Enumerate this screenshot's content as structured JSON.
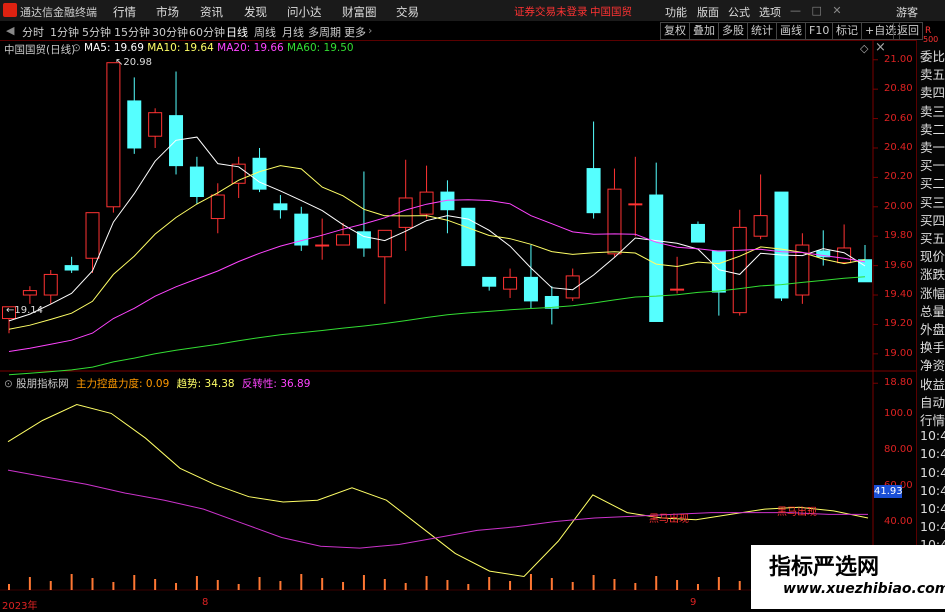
{
  "app": {
    "title": "通达信金融终端",
    "status": "证券交易未登录",
    "stock_name": "中国国贸"
  },
  "menu": [
    "行情",
    "市场",
    "资讯",
    "发现",
    "问小达",
    "财富圈",
    "交易"
  ],
  "right_menu": [
    "功能",
    "版面",
    "公式",
    "选项"
  ],
  "guest": "游客",
  "periods": [
    "分时",
    "1分钟",
    "5分钟",
    "15分钟",
    "30分钟",
    "60分钟",
    "日线",
    "周线",
    "月线",
    "多周期",
    "更多"
  ],
  "active_period": "日线",
  "tools": [
    "复权",
    "叠加",
    "多股",
    "统计",
    "画线",
    "F10",
    "标记",
    "+自选",
    "返回"
  ],
  "right_panel_top": {
    "r": "R",
    "num": "500"
  },
  "right_panel": [
    "委比",
    "卖五",
    "卖四",
    "卖三",
    "卖二",
    "卖一",
    "买一",
    "买二",
    "买三",
    "买四",
    "买五",
    "现价",
    "涨跌",
    "涨幅",
    "总量",
    "外盘",
    "换手",
    "净资",
    "收益",
    "自动",
    "行情",
    "10:4",
    "10:45",
    "10:45",
    "10:45",
    "10:45",
    "10:45",
    "10:45",
    "10:45",
    "10:45",
    "10:45"
  ],
  "main_chart": {
    "label": "中国国贸(日线)",
    "ma": [
      {
        "name": "MA5",
        "value": "19.69",
        "color": "#ffffff"
      },
      {
        "name": "MA10",
        "value": "19.64",
        "color": "#ffff66"
      },
      {
        "name": "MA20",
        "value": "19.66",
        "color": "#ff44ff"
      },
      {
        "name": "MA60",
        "value": "19.50",
        "color": "#33dd33"
      }
    ],
    "high_label": "20.98",
    "low_label": "19.14",
    "y_ticks": [
      "21.00",
      "20.80",
      "20.60",
      "20.40",
      "20.20",
      "20.00",
      "19.80",
      "19.60",
      "19.40",
      "19.20",
      "19.00",
      "18.80"
    ],
    "y_range": [
      18.72,
      21.08
    ]
  },
  "sub_chart": {
    "label": "股朋指标网",
    "items": [
      {
        "name": "主力控盘力度",
        "value": "0.09",
        "color": "#ff9900"
      },
      {
        "name": "趋势",
        "value": "34.38",
        "color": "#ffff66"
      },
      {
        "name": "反转性",
        "value": "36.89",
        "color": "#ff44ff"
      }
    ],
    "y_ticks": [
      "100.0",
      "80.00",
      "60.00",
      "40.00"
    ],
    "current": "41.93",
    "annotation1": "黑马出现",
    "annotation2": "黑马出现"
  },
  "x_labels": [
    "2023年",
    "8",
    "9"
  ],
  "watermark": {
    "line1": "指标严选网",
    "line2": "www.xuezhibiao.com"
  },
  "chart_data": {
    "type": "candlestick",
    "candles": [
      {
        "o": 19.24,
        "h": 19.32,
        "l": 19.14,
        "c": 19.32
      },
      {
        "o": 19.4,
        "h": 19.46,
        "l": 19.34,
        "c": 19.43
      },
      {
        "o": 19.4,
        "h": 19.57,
        "l": 19.34,
        "c": 19.54
      },
      {
        "o": 19.6,
        "h": 19.66,
        "l": 19.55,
        "c": 19.57
      },
      {
        "o": 19.65,
        "h": 19.82,
        "l": 19.55,
        "c": 19.96
      },
      {
        "o": 20.0,
        "h": 20.98,
        "l": 19.96,
        "c": 20.98
      },
      {
        "o": 20.72,
        "h": 20.88,
        "l": 20.36,
        "c": 20.4
      },
      {
        "o": 20.48,
        "h": 20.67,
        "l": 20.4,
        "c": 20.64
      },
      {
        "o": 20.62,
        "h": 20.92,
        "l": 20.22,
        "c": 20.28
      },
      {
        "o": 20.27,
        "h": 20.34,
        "l": 20.02,
        "c": 20.07
      },
      {
        "o": 19.92,
        "h": 20.16,
        "l": 19.82,
        "c": 20.08
      },
      {
        "o": 20.16,
        "h": 20.34,
        "l": 20.06,
        "c": 20.29
      },
      {
        "o": 20.33,
        "h": 20.4,
        "l": 20.1,
        "c": 20.12
      },
      {
        "o": 20.02,
        "h": 20.08,
        "l": 19.92,
        "c": 19.98
      },
      {
        "o": 19.95,
        "h": 20.0,
        "l": 19.7,
        "c": 19.74
      },
      {
        "o": 19.74,
        "h": 19.92,
        "l": 19.64,
        "c": 19.74
      },
      {
        "o": 19.74,
        "h": 19.89,
        "l": 19.74,
        "c": 19.81
      },
      {
        "o": 19.83,
        "h": 20.24,
        "l": 19.66,
        "c": 19.72
      },
      {
        "o": 19.66,
        "h": 19.78,
        "l": 19.34,
        "c": 19.84
      },
      {
        "o": 19.86,
        "h": 20.32,
        "l": 19.7,
        "c": 20.06
      },
      {
        "o": 19.95,
        "h": 20.28,
        "l": 19.92,
        "c": 20.1
      },
      {
        "o": 20.1,
        "h": 20.18,
        "l": 19.82,
        "c": 19.98
      },
      {
        "o": 19.99,
        "h": 19.99,
        "l": 19.6,
        "c": 19.6
      },
      {
        "o": 19.52,
        "h": 19.52,
        "l": 19.43,
        "c": 19.46
      },
      {
        "o": 19.44,
        "h": 19.58,
        "l": 19.38,
        "c": 19.52
      },
      {
        "o": 19.52,
        "h": 19.74,
        "l": 19.31,
        "c": 19.36
      },
      {
        "o": 19.39,
        "h": 19.46,
        "l": 19.2,
        "c": 19.31
      },
      {
        "o": 19.38,
        "h": 19.58,
        "l": 19.36,
        "c": 19.53
      },
      {
        "o": 20.26,
        "h": 20.58,
        "l": 19.92,
        "c": 19.96
      },
      {
        "o": 19.68,
        "h": 20.26,
        "l": 19.66,
        "c": 20.12
      },
      {
        "o": 20.02,
        "h": 20.34,
        "l": 19.8,
        "c": 20.02
      },
      {
        "o": 20.08,
        "h": 20.3,
        "l": 19.22,
        "c": 19.22
      },
      {
        "o": 19.44,
        "h": 19.66,
        "l": 19.41,
        "c": 19.44
      },
      {
        "o": 19.88,
        "h": 19.9,
        "l": 19.76,
        "c": 19.76
      },
      {
        "o": 19.7,
        "h": 19.7,
        "l": 19.26,
        "c": 19.42
      },
      {
        "o": 19.28,
        "h": 19.98,
        "l": 19.26,
        "c": 19.86
      },
      {
        "o": 19.8,
        "h": 20.22,
        "l": 19.78,
        "c": 19.94
      },
      {
        "o": 20.1,
        "h": 20.1,
        "l": 19.36,
        "c": 19.38
      },
      {
        "o": 19.4,
        "h": 19.82,
        "l": 19.34,
        "c": 19.74
      },
      {
        "o": 19.7,
        "h": 19.84,
        "l": 19.6,
        "c": 19.66
      },
      {
        "o": 19.62,
        "h": 19.88,
        "l": 19.62,
        "c": 19.72
      },
      {
        "o": 19.64,
        "h": 19.74,
        "l": 19.49,
        "c": 19.49
      }
    ]
  }
}
